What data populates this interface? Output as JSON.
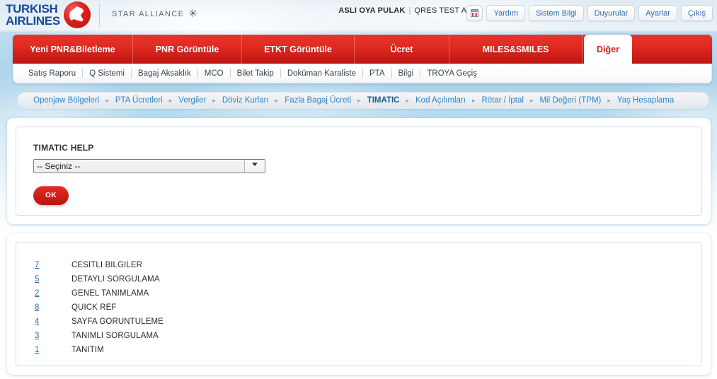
{
  "brand": {
    "logo_line1": "TURKISH",
    "logo_line2": "AIRLINES",
    "alliance_text": "STAR ALLIANCE",
    "star_glyph": "✳",
    "red": "#d0211b",
    "blue": "#17479e",
    "link_blue": "#2f6ea8"
  },
  "header": {
    "user_name": "ASLI OYA PULAK",
    "separator": "|",
    "agency": "QRES TEST AGT",
    "calendar_icon": "calendar-icon",
    "buttons": [
      {
        "label": "Yardım",
        "name": "help-button"
      },
      {
        "label": "Sistem Bilgi",
        "name": "system-info-button"
      },
      {
        "label": "Duyurular",
        "name": "announcements-button"
      },
      {
        "label": "Ayarlar",
        "name": "settings-button"
      },
      {
        "label": "Çıkış",
        "name": "logout-button"
      }
    ]
  },
  "main_nav": {
    "tabs": [
      {
        "label": "Yeni PNR&Biletleme",
        "active": false
      },
      {
        "label": "PNR Görüntüle",
        "active": false
      },
      {
        "label": "ETKT Görüntüle",
        "active": false
      },
      {
        "label": "Ücret",
        "active": false
      },
      {
        "label": "MILES&SMILES",
        "active": false
      },
      {
        "label": "Diğer",
        "active": true
      }
    ]
  },
  "submenu": {
    "items": [
      "Satış Raporu",
      "Q Sistemi",
      "Bagaj Aksaklık",
      "MCO",
      "Bilet Takip",
      "Doküman Karaliste",
      "PTA",
      "Bilgi",
      "TROYA Geçiş"
    ]
  },
  "breadcrumb": {
    "arrow": "▸",
    "items": [
      {
        "label": "Openjaw Bölgeleri",
        "active": false
      },
      {
        "label": "PTA Ücretleri",
        "active": false
      },
      {
        "label": "Vergiler",
        "active": false
      },
      {
        "label": "Döviz Kurları",
        "active": false
      },
      {
        "label": "Fazla Bagaj Ücreti",
        "active": false
      },
      {
        "label": "TIMATIC",
        "active": true
      },
      {
        "label": "Kod Açılımları",
        "active": false
      },
      {
        "label": "Rötar / İptal",
        "active": false
      },
      {
        "label": "Mil Değeri (TPM)",
        "active": false
      },
      {
        "label": "Yaş Hesaplama",
        "active": false
      }
    ]
  },
  "form_panel": {
    "title": "TIMATIC HELP",
    "select": {
      "selected": "-- Seçiniz --",
      "options": [
        "-- Seçiniz --"
      ]
    },
    "ok_label": "OK"
  },
  "list_panel": {
    "rows": [
      {
        "num": "7",
        "label": "CESITLI BILGILER"
      },
      {
        "num": "5",
        "label": "DETAYLI SORGULAMA"
      },
      {
        "num": "2",
        "label": "GENEL TANIMLAMA"
      },
      {
        "num": "8",
        "label": "QUICK REF"
      },
      {
        "num": "4",
        "label": "SAYFA GORUNTULEME"
      },
      {
        "num": "3",
        "label": "TANIMLI SORGULAMA"
      },
      {
        "num": "1",
        "label": "TANITIM"
      }
    ]
  }
}
